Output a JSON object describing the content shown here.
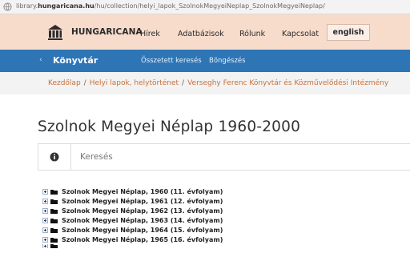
{
  "browser": {
    "url_prefix": "library.",
    "url_domain": "hungaricana.hu",
    "url_path": "/hu/collection/helyi_lapok_SzolnokMegyeiNeplap_SzolnokMegyeiNeplap/"
  },
  "header": {
    "logo_text": "HUNGARICANA",
    "nav": [
      "Hírek",
      "Adatbázisok",
      "Rólunk",
      "Kapcsolat"
    ],
    "lang_button": "english"
  },
  "subnav": {
    "title": "Könyvtár",
    "links": [
      "Összetett keresés",
      "Böngészés"
    ]
  },
  "breadcrumb": [
    "Kezdőlap",
    "Helyi lapok, helytörténet",
    "Verseghy Ferenc Könyvtár és Közművelődési Intézmény"
  ],
  "page": {
    "title": "Szolnok Megyei Néplap 1960-2000"
  },
  "search": {
    "placeholder": "Keresés"
  },
  "tree": {
    "items": [
      "Szolnok Megyei Néplap, 1960 (11. évfolyam)",
      "Szolnok Megyei Néplap, 1961 (12. évfolyam)",
      "Szolnok Megyei Néplap, 1962 (13. évfolyam)",
      "Szolnok Megyei Néplap, 1963 (14. évfolyam)",
      "Szolnok Megyei Néplap, 1964 (15. évfolyam)",
      "Szolnok Megyei Néplap, 1965 (16. évfolyam)"
    ]
  },
  "colors": {
    "header_bg": "#f7dccc",
    "bluebar_bg": "#2e75b6",
    "breadcrumb_link": "#c9703a"
  }
}
